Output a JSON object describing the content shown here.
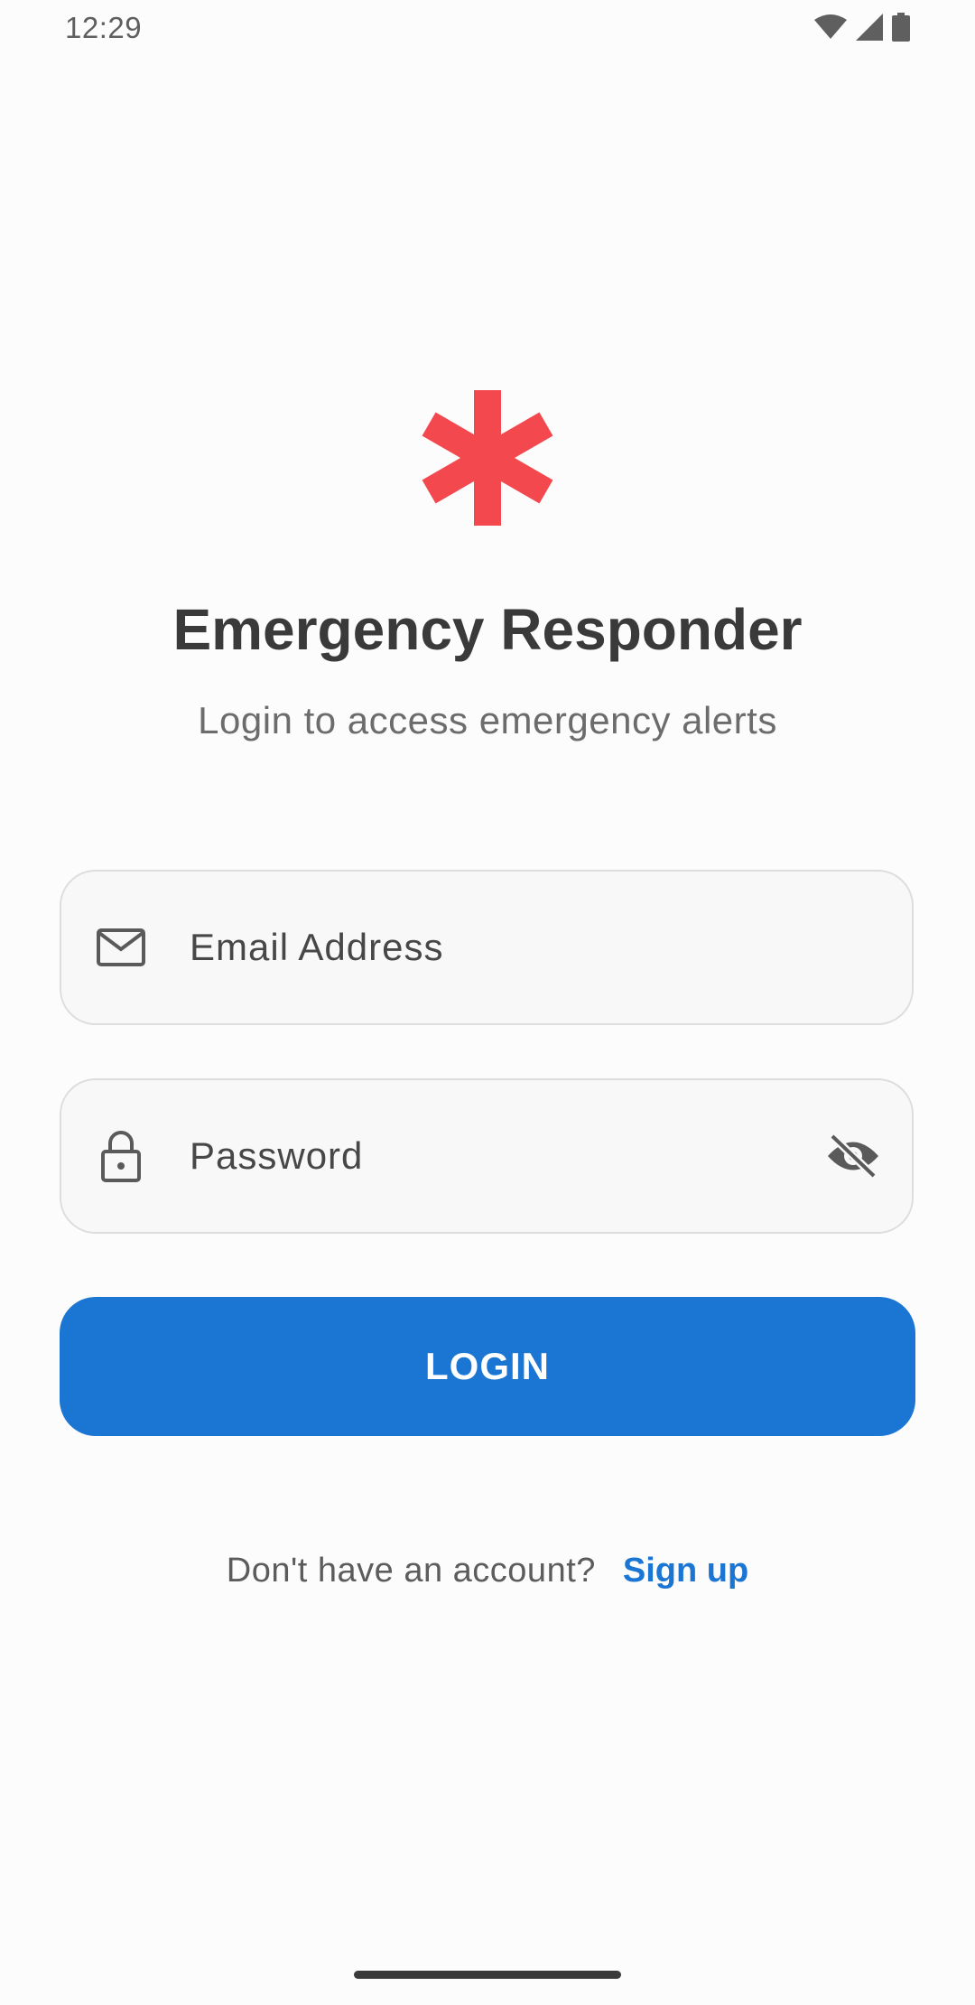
{
  "status_bar": {
    "time": "12:29",
    "icons": [
      "wifi-icon",
      "cellular-signal-icon",
      "battery-icon"
    ]
  },
  "app": {
    "logo_icon": "medical-asterisk-icon",
    "logo_color": "#f4484f",
    "title": "Emergency Responder",
    "subtitle": "Login to access emergency alerts"
  },
  "form": {
    "email": {
      "placeholder": "Email Address",
      "value": "",
      "icon": "mail-icon"
    },
    "password": {
      "placeholder": "Password",
      "value": "",
      "icon": "lock-icon",
      "toggle_icon": "eye-off-icon"
    },
    "login_label": "LOGIN"
  },
  "signup": {
    "prompt": "Don't have an account?",
    "link_label": "Sign up"
  },
  "colors": {
    "primary": "#1a76d2",
    "accent": "#f4484f",
    "text": "#3a3a3a"
  }
}
